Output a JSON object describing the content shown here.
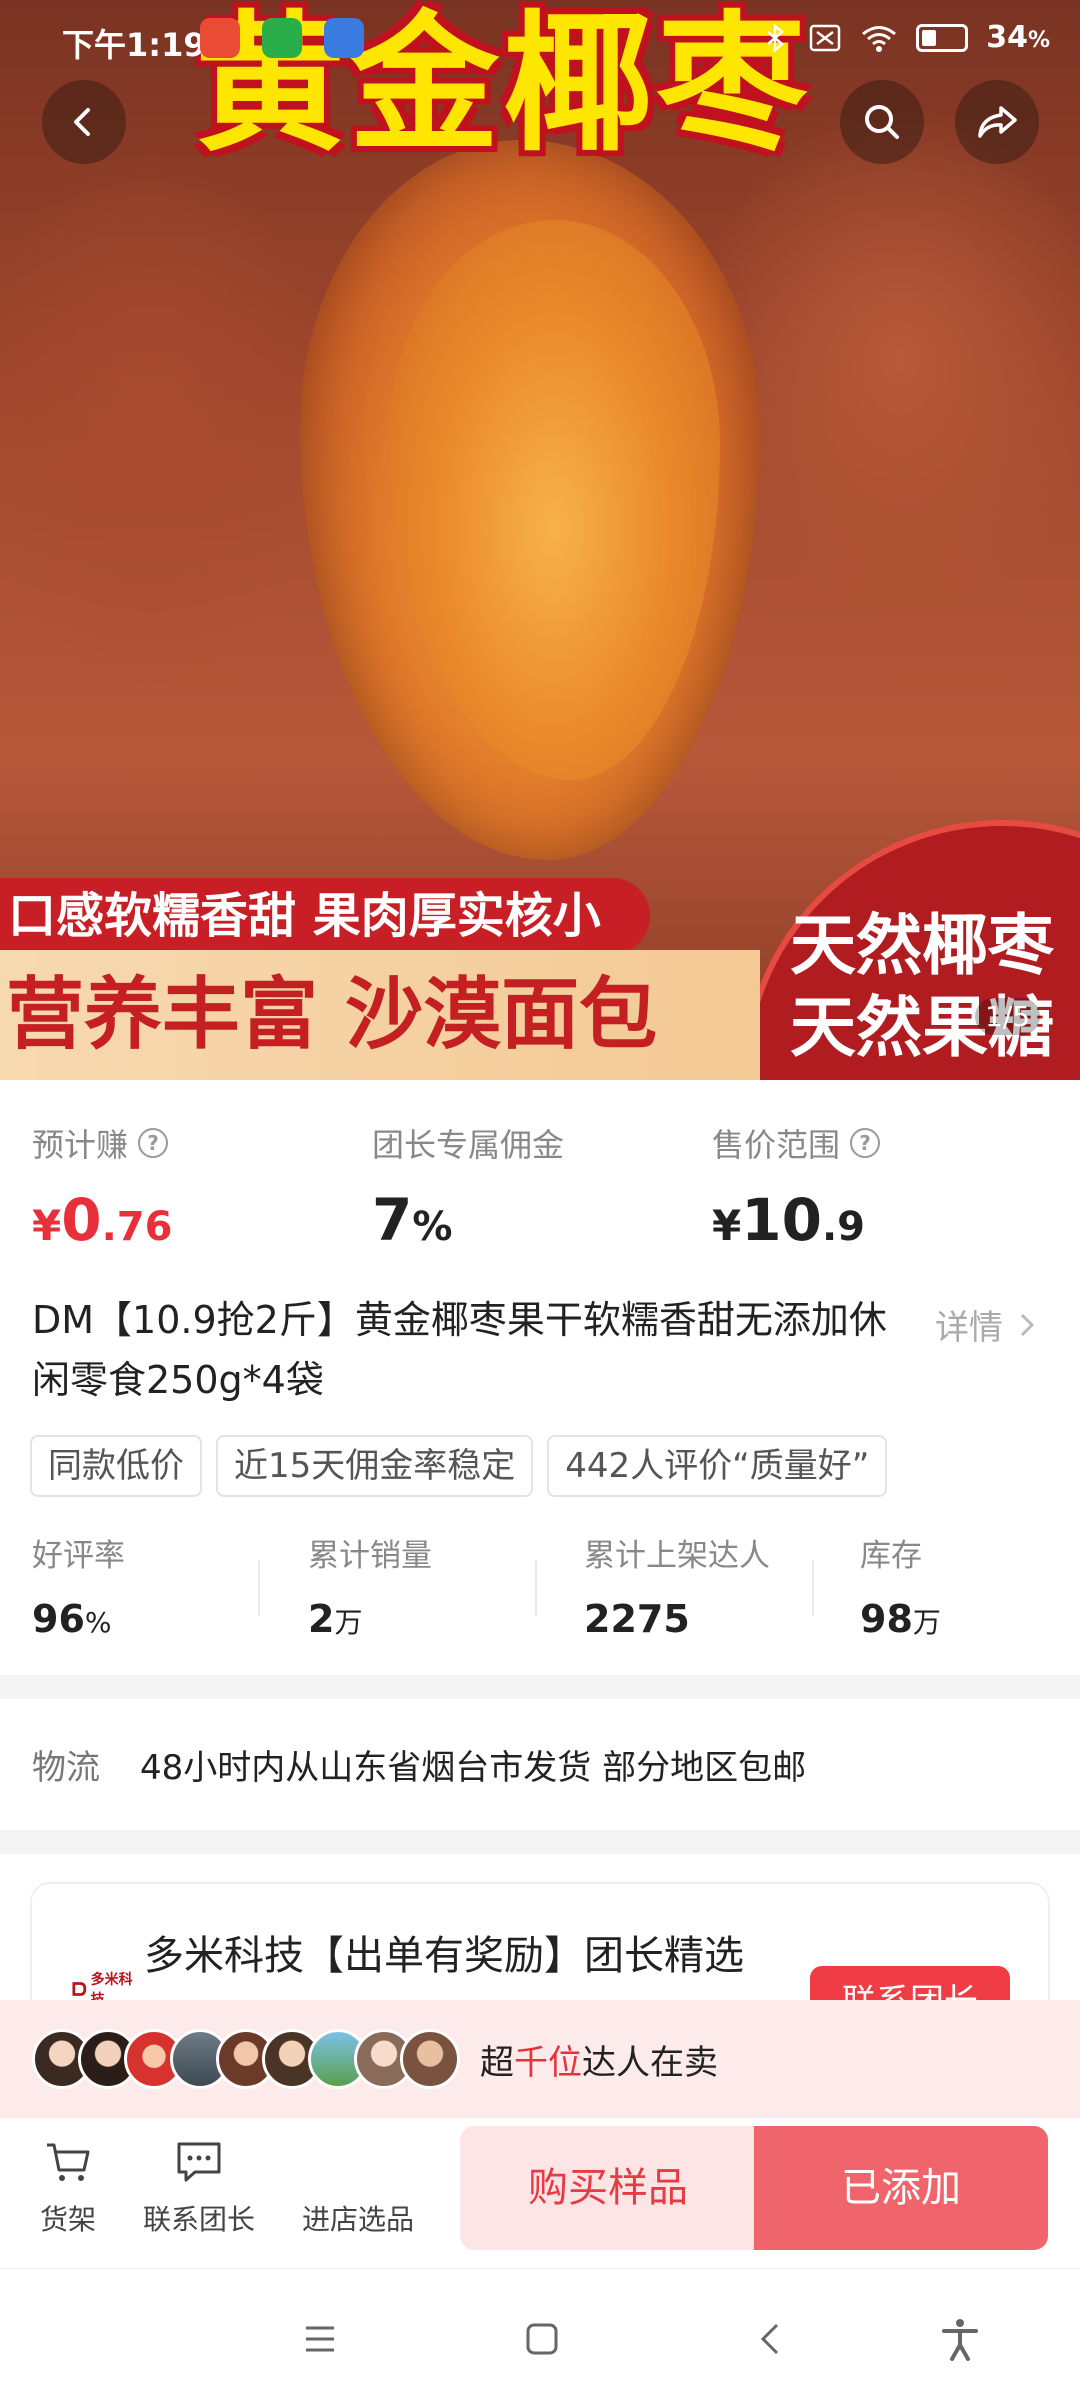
{
  "status_bar": {
    "time": "下午1:19",
    "battery_percent": "34",
    "battery_unit": "%"
  },
  "hero": {
    "headline": "黄金椰枣",
    "banner_line1": "口感软糯香甜  果肉厚实核小",
    "banner_line2": "营养丰富  沙漠面包",
    "badge_line1": "天然椰枣",
    "badge_line2": "天然果糖",
    "page_indicator": "1/5"
  },
  "stats": {
    "earn": {
      "label": "预计赚",
      "currency": "¥",
      "int": "0",
      "dec": ".76"
    },
    "commission": {
      "label": "团长专属佣金",
      "value": "7",
      "unit": "%"
    },
    "price_range": {
      "label": "售价范围",
      "currency": "¥",
      "int": "10",
      "dec": ".9"
    }
  },
  "product": {
    "title": " DM【10.9抢2斤】黄金椰枣果干软糯香甜无添加休闲零食250g*4袋",
    "detail_link": "详情"
  },
  "tags": [
    "同款低价",
    "近15天佣金率稳定",
    "442人评价“质量好”"
  ],
  "metrics": [
    {
      "label": "好评率",
      "value": "96",
      "unit": "%"
    },
    {
      "label": "累计销量",
      "value": "2",
      "unit": "万"
    },
    {
      "label": "累计上架达人",
      "value": "2275",
      "unit": ""
    },
    {
      "label": "库存",
      "value": "98",
      "unit": "万"
    }
  ],
  "logistics": {
    "label": "物流",
    "value": "48小时内从山东省烟台市发货 部分地区包邮"
  },
  "shop": {
    "logo_text": "多米科技",
    "name": "多米科技【出单有奖励】团长精选",
    "contact_label": "联系团长"
  },
  "sellers": {
    "prefix": "超",
    "highlight": "千位",
    "suffix": "达人在卖"
  },
  "actions": {
    "shelf": "货架",
    "contact": "联系团长",
    "store": "进店选品",
    "buy_sample": "购买样品",
    "added": "已添加"
  },
  "colors": {
    "accent_red": "#e8303a",
    "added_button": "#f0656b",
    "buy_sample_bg": "#fde4e5"
  }
}
